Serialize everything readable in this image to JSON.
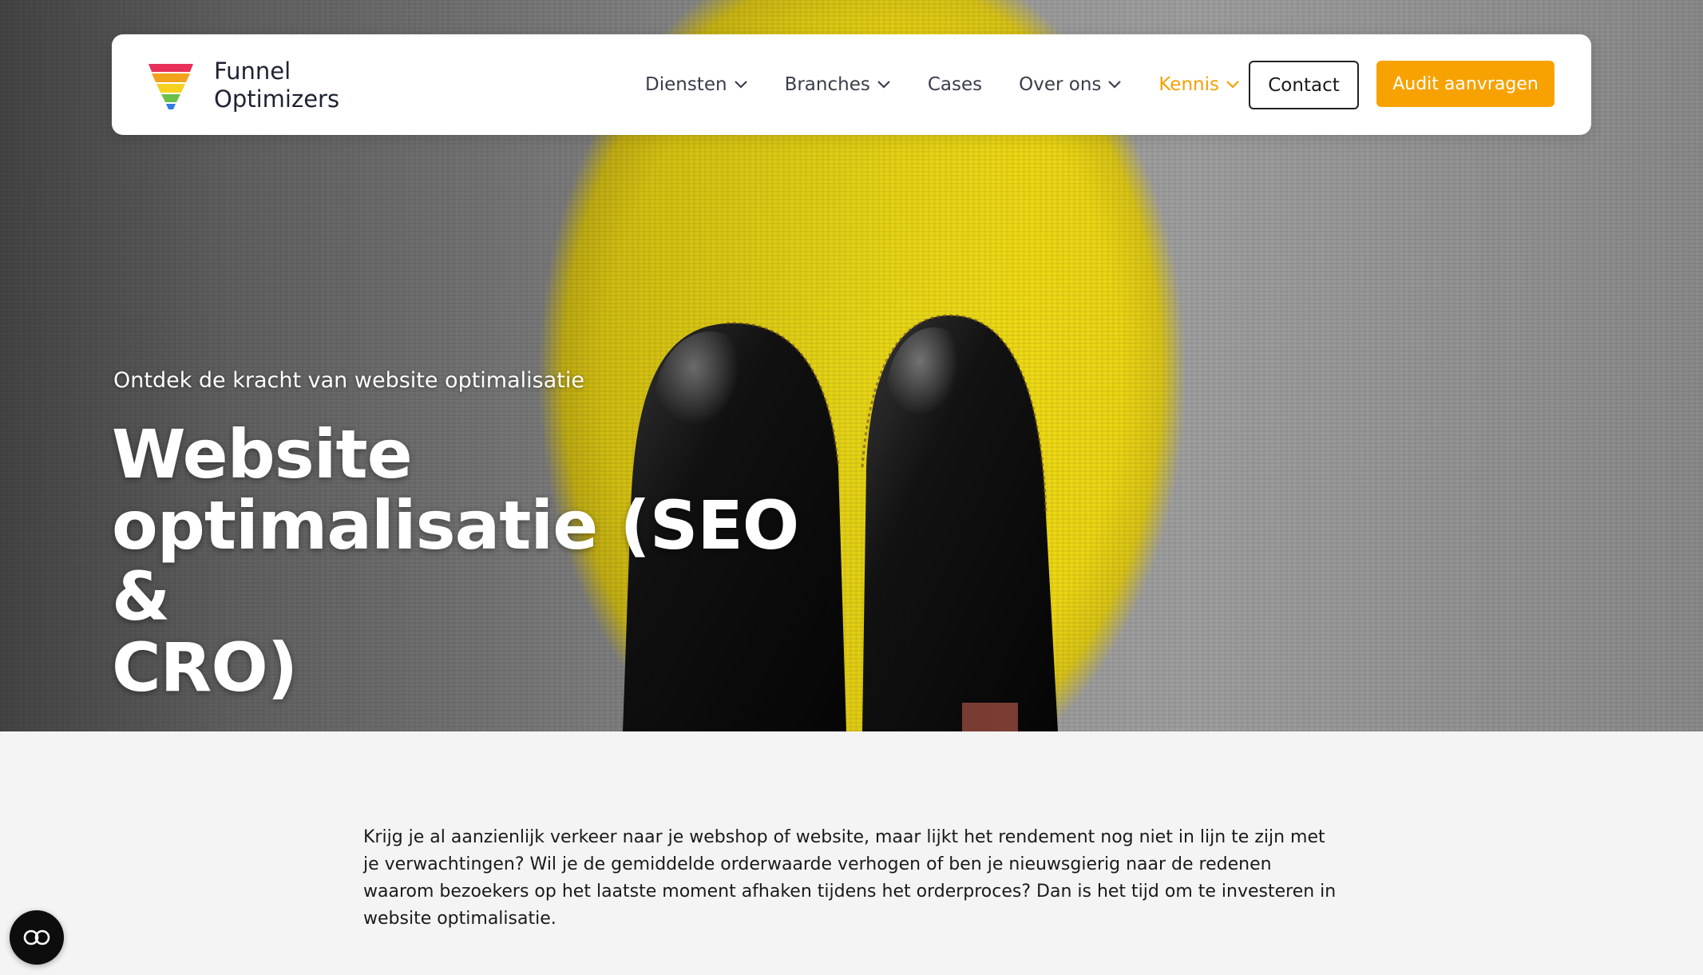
{
  "brand": {
    "name_line1": "Funnel",
    "name_line2": "Optimizers",
    "logo_icon": "funnel-icon"
  },
  "nav": {
    "items": [
      {
        "label": "Diensten",
        "has_dropdown": true,
        "active": false
      },
      {
        "label": "Branches",
        "has_dropdown": true,
        "active": false
      },
      {
        "label": "Cases",
        "has_dropdown": false,
        "active": false
      },
      {
        "label": "Over ons",
        "has_dropdown": true,
        "active": false
      },
      {
        "label": "Kennis",
        "has_dropdown": true,
        "active": true
      }
    ],
    "contact_label": "Contact",
    "audit_label": "Audit aanvragen"
  },
  "hero": {
    "subtitle": "Ontdek de kracht van website optimalisatie",
    "title_line1": "Website",
    "title_line2": "optimalisatie (SEO &",
    "title_line3": "CRO)"
  },
  "content": {
    "intro": "Krijg je al aanzienlijk verkeer naar je webshop of website, maar lijkt het rendement nog niet in lijn te zijn met je verwachtingen? Wil je de gemiddelde orderwaarde verhogen of ben je nieuwsgierig naar de redenen waarom bezoekers op het laatste moment afhaken tijdens het orderproces? Dan is het tijd om te investeren in website optimalisatie."
  },
  "floating_button": {
    "icon": "accessibility-icon"
  },
  "colors": {
    "accent": "#f8a201",
    "active_nav": "#f5a003",
    "text_dark": "#1e2233",
    "content_bg": "#f4f4f4"
  }
}
